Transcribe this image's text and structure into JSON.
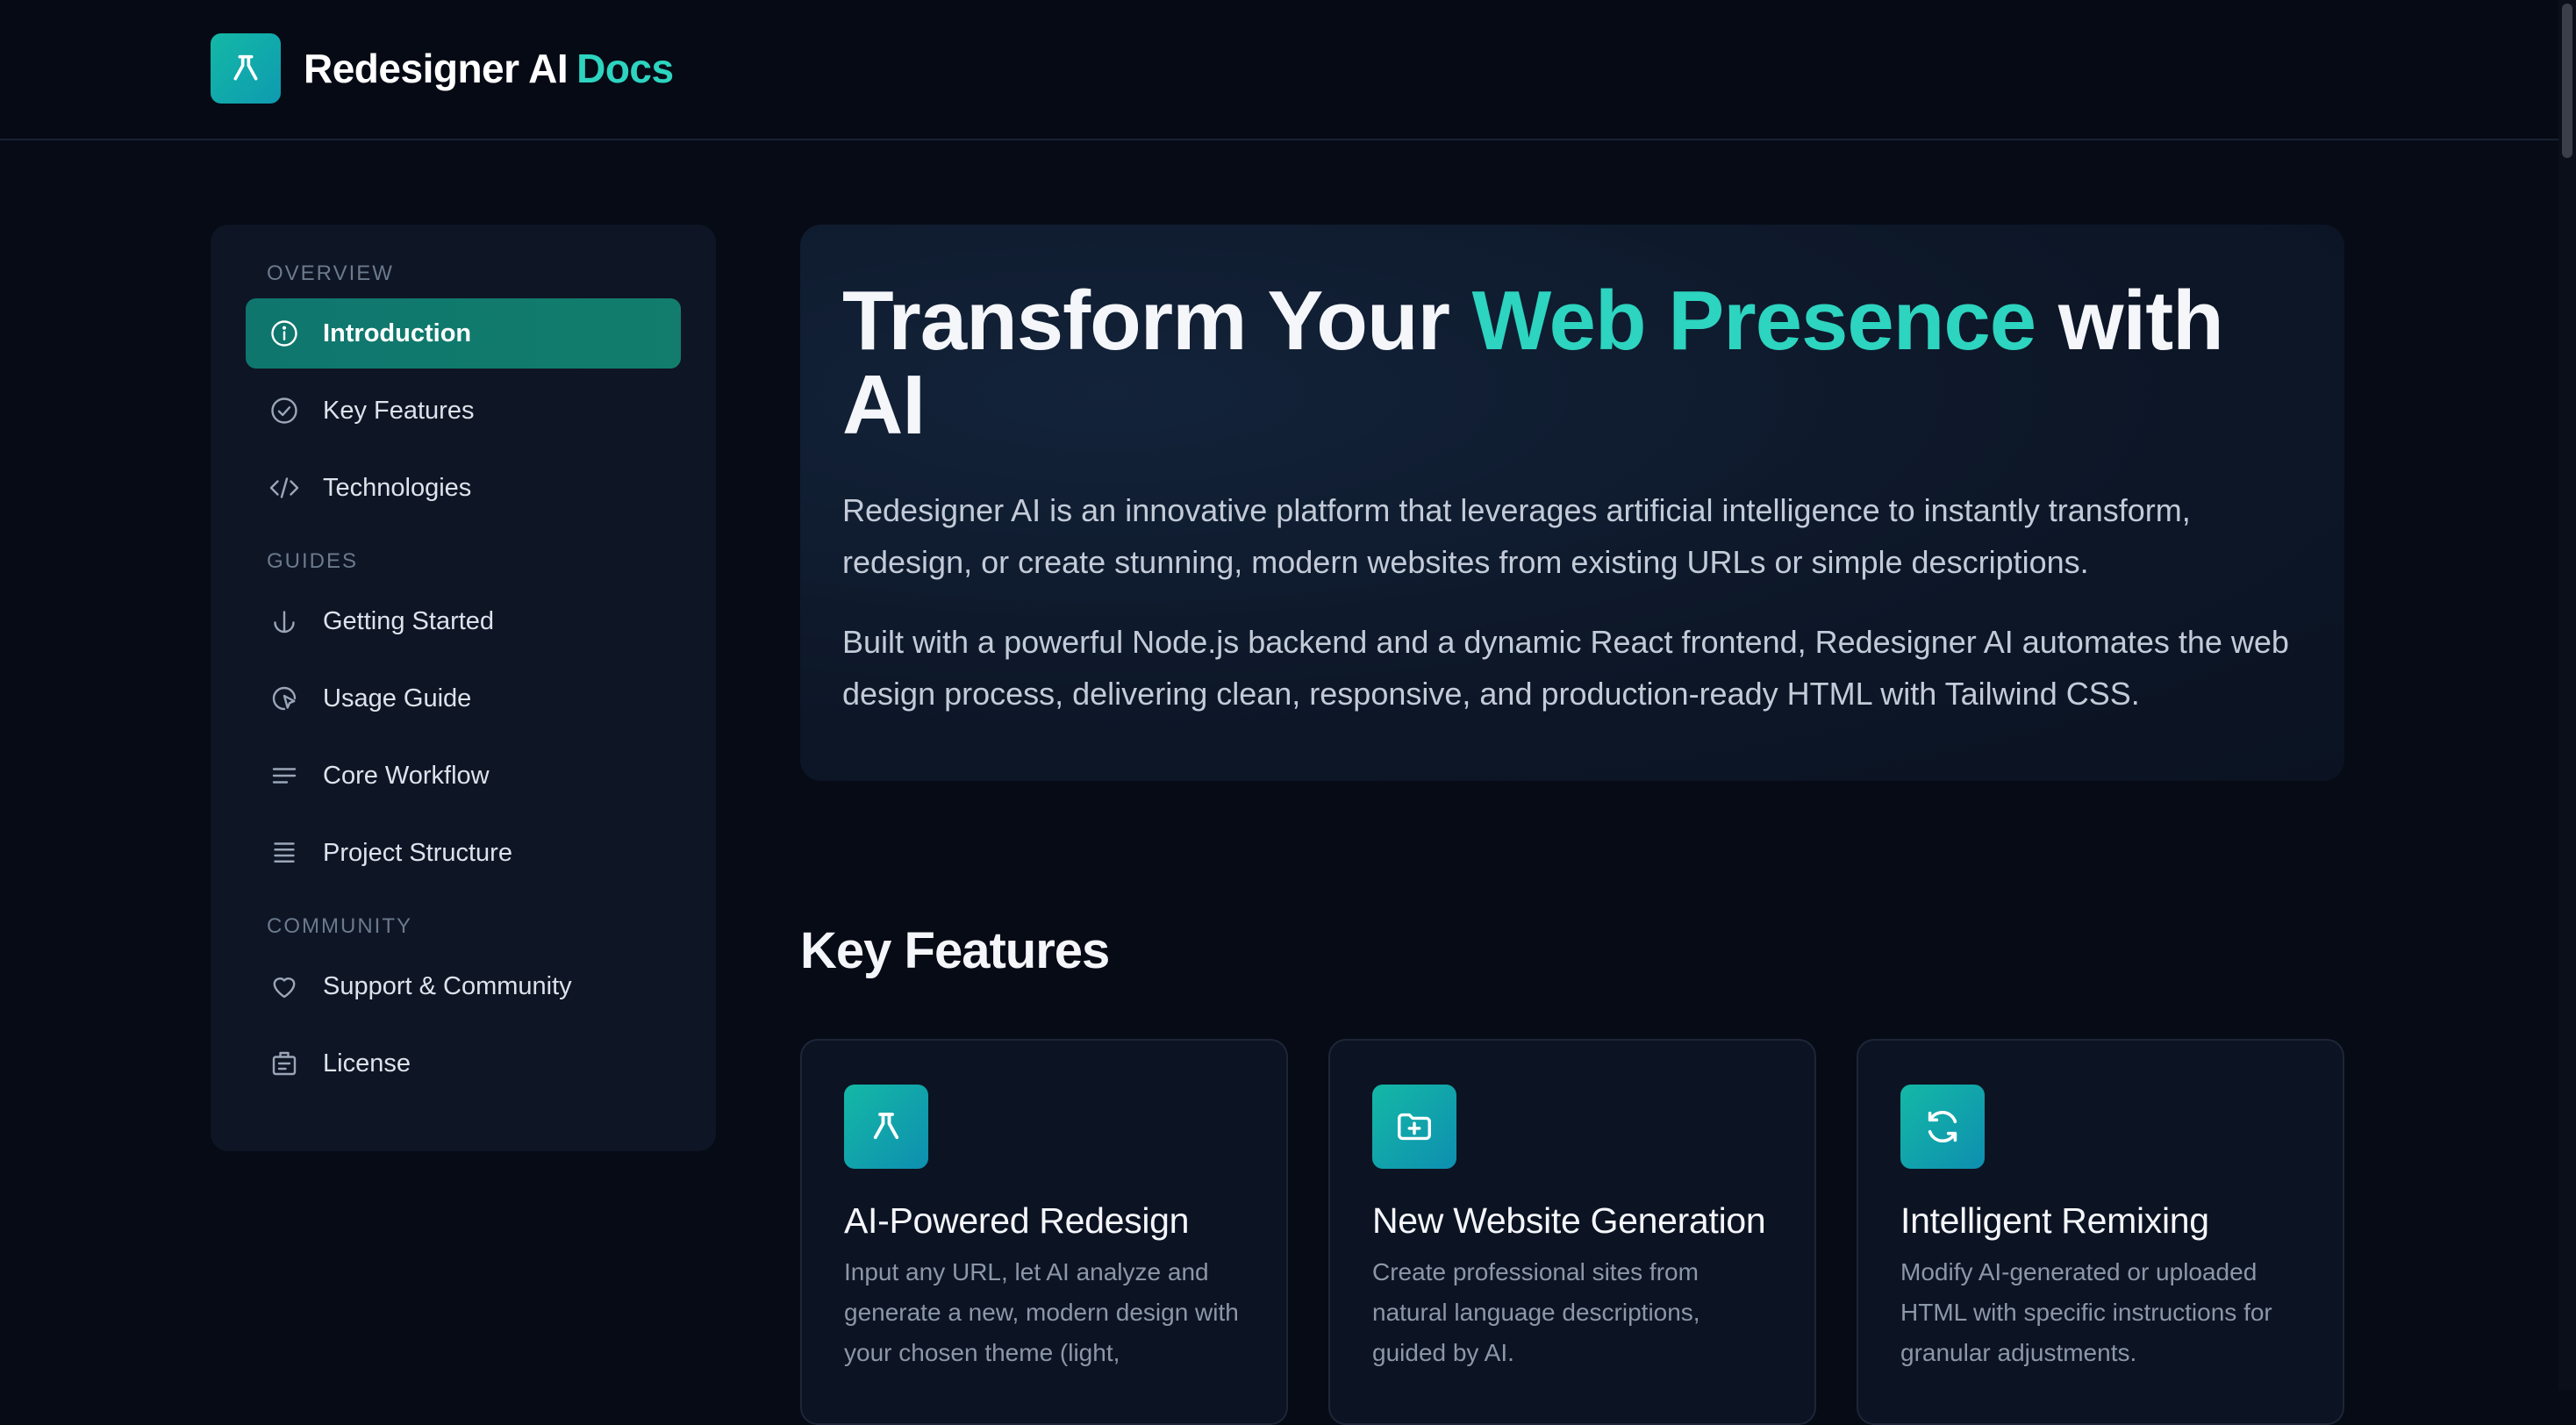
{
  "header": {
    "brand_name": "Redesigner AI",
    "brand_accent": "Docs",
    "logo_icon": "beaker-icon"
  },
  "sidebar": {
    "sections": [
      {
        "title": "OVERVIEW",
        "items": [
          {
            "label": "Introduction",
            "icon": "info-icon",
            "active": true
          },
          {
            "label": "Key Features",
            "icon": "check-circle-icon",
            "active": false
          },
          {
            "label": "Technologies",
            "icon": "code-icon",
            "active": false
          }
        ]
      },
      {
        "title": "GUIDES",
        "items": [
          {
            "label": "Getting Started",
            "icon": "anchor-icon",
            "active": false
          },
          {
            "label": "Usage Guide",
            "icon": "cursor-click-icon",
            "active": false
          },
          {
            "label": "Core Workflow",
            "icon": "menu-lines-icon",
            "active": false
          },
          {
            "label": "Project Structure",
            "icon": "list-icon",
            "active": false
          }
        ]
      },
      {
        "title": "COMMUNITY",
        "items": [
          {
            "label": "Support & Community",
            "icon": "heart-icon",
            "active": false
          },
          {
            "label": "License",
            "icon": "license-icon",
            "active": false
          }
        ]
      }
    ]
  },
  "hero": {
    "title_part1": "Transform Your ",
    "title_accent": "Web Presence",
    "title_part2": " with AI",
    "paragraph1": "Redesigner AI is an innovative platform that leverages artificial intelligence to instantly transform, redesign, or create stunning, modern websites from existing URLs or simple descriptions.",
    "paragraph2": "Built with a powerful Node.js backend and a dynamic React frontend, Redesigner AI automates the web design process, delivering clean, responsive, and production-ready HTML with Tailwind CSS."
  },
  "features": {
    "heading": "Key Features",
    "cards": [
      {
        "title": "AI-Powered Redesign",
        "icon": "beaker-icon",
        "description": "Input any URL, let AI analyze and generate a new, modern design with your chosen theme (light,"
      },
      {
        "title": "New Website Generation",
        "icon": "folder-plus-icon",
        "description": "Create professional sites from natural language descriptions, guided by AI."
      },
      {
        "title": "Intelligent Remixing",
        "icon": "refresh-icon",
        "description": "Modify AI-generated or uploaded HTML with specific instructions for granular adjustments."
      }
    ]
  },
  "colors": {
    "background": "#070b16",
    "accent": "#2dd4bf",
    "active_nav": "#0f766e",
    "card": "#0e1524"
  }
}
